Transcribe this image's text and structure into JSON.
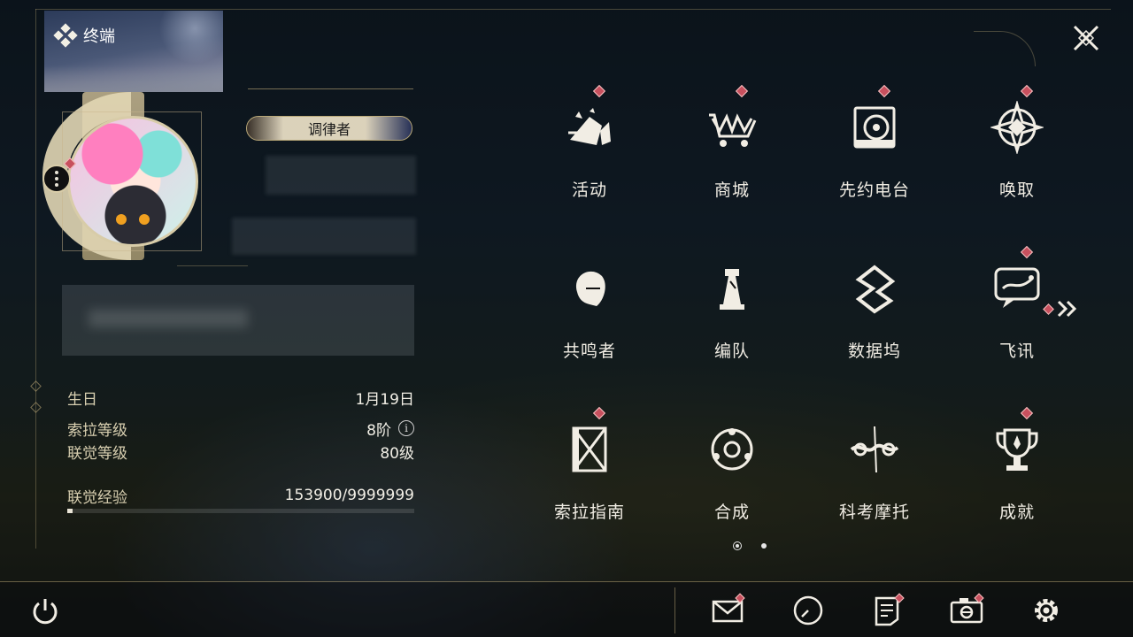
{
  "terminal": {
    "title": "终端"
  },
  "profile": {
    "role_badge": "调律者",
    "stats": [
      {
        "label": "生日",
        "value": "1月19日"
      },
      {
        "label": "索拉等级",
        "value": "8阶",
        "info": "i"
      },
      {
        "label": "联觉等级",
        "value": "80级"
      }
    ],
    "exp": {
      "label": "联觉经验",
      "value": "153900/9999999",
      "fraction": 0.0154
    }
  },
  "menu": {
    "items": [
      {
        "label": "活动",
        "icon": "event-icon",
        "badge": true
      },
      {
        "label": "商城",
        "icon": "shop-crown-cart-icon",
        "badge": true
      },
      {
        "label": "先约电台",
        "icon": "radio-icon",
        "badge": true
      },
      {
        "label": "唤取",
        "icon": "summon-compass-icon",
        "badge": true
      },
      {
        "label": "共鸣者",
        "icon": "resonator-portrait-icon",
        "badge": false
      },
      {
        "label": "编队",
        "icon": "team-chess-icon",
        "badge": false
      },
      {
        "label": "数据坞",
        "icon": "data-dock-icon",
        "badge": false
      },
      {
        "label": "飞讯",
        "icon": "message-bubble-icon",
        "badge": true
      },
      {
        "label": "索拉指南",
        "icon": "guidebook-icon",
        "badge": true
      },
      {
        "label": "合成",
        "icon": "synthesis-icon",
        "badge": false
      },
      {
        "label": "科考摩托",
        "icon": "motorbike-icon",
        "badge": false
      },
      {
        "label": "成就",
        "icon": "trophy-icon",
        "badge": true
      }
    ],
    "next_page_icon": "double-chevron-right-icon",
    "pages": 2,
    "current_page": 1
  },
  "toolbar": {
    "buttons": [
      {
        "name": "mail",
        "icon": "mail-icon",
        "badge": true
      },
      {
        "name": "clock",
        "icon": "clock-icon",
        "badge": false
      },
      {
        "name": "notes",
        "icon": "notes-icon",
        "badge": true
      },
      {
        "name": "camera",
        "icon": "camera-icon",
        "badge": true
      },
      {
        "name": "settings",
        "icon": "gear-icon",
        "badge": false
      }
    ]
  },
  "colors": {
    "accent_gold": "#b9a878",
    "badge_red": "#c8505e",
    "text": "#f1ede4"
  }
}
